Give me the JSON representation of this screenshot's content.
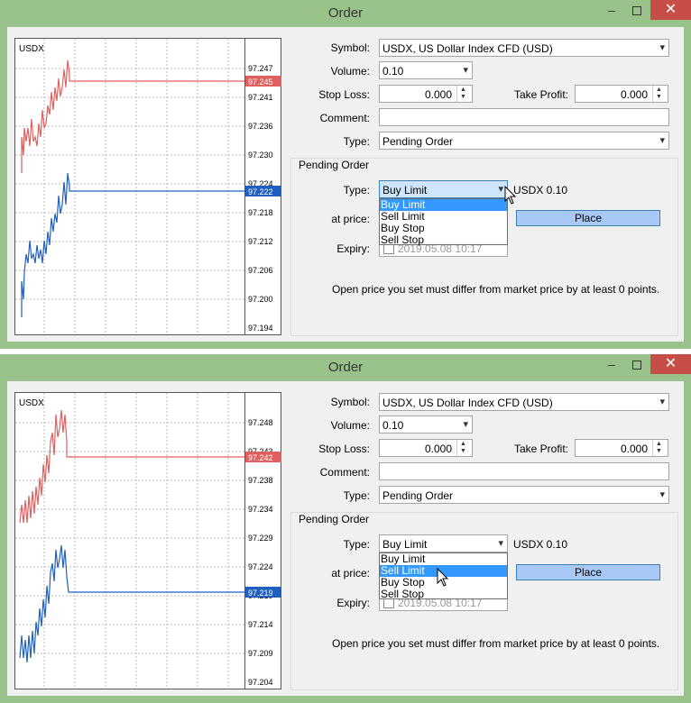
{
  "windows": [
    {
      "title": "Order",
      "chart": {
        "symbol": "USDX",
        "price_labels": [
          "97.247",
          "97.241",
          "97.236",
          "97.230",
          "97.224",
          "97.218",
          "97.212",
          "97.206",
          "97.200",
          "97.194"
        ],
        "ask_tag": "97.245",
        "bid_tag": "97.222"
      },
      "form": {
        "symbol_label": "Symbol:",
        "symbol_value": "USDX, US Dollar Index CFD (USD)",
        "volume_label": "Volume:",
        "volume_value": "0.10",
        "stop_loss_label": "Stop Loss:",
        "stop_loss_value": "0.000",
        "take_profit_label": "Take Profit:",
        "take_profit_value": "0.000",
        "comment_label": "Comment:",
        "comment_value": "",
        "type_label": "Type:",
        "type_value": "Pending Order"
      },
      "pending": {
        "group_title": "Pending Order",
        "type_label": "Type:",
        "type_value": "Buy Limit",
        "options": [
          "Buy Limit",
          "Sell Limit",
          "Buy Stop",
          "Sell Stop"
        ],
        "highlighted": "Buy Limit",
        "summary": "USDX 0.10",
        "at_price_label": "at price:",
        "place_label": "Place",
        "expiry_label": "Expiry:",
        "expiry_value": "2019.05.08 10:17",
        "note": "Open price you set must differ from market price by at least 0 points."
      }
    },
    {
      "title": "Order",
      "chart": {
        "symbol": "USDX",
        "price_labels": [
          "97.248",
          "97.243",
          "97.238",
          "97.234",
          "97.229",
          "97.224",
          "97.219",
          "97.214",
          "97.209",
          "97.204"
        ],
        "ask_tag": "97.242",
        "bid_tag": "97.219"
      },
      "form": {
        "symbol_label": "Symbol:",
        "symbol_value": "USDX, US Dollar Index CFD (USD)",
        "volume_label": "Volume:",
        "volume_value": "0.10",
        "stop_loss_label": "Stop Loss:",
        "stop_loss_value": "0.000",
        "take_profit_label": "Take Profit:",
        "take_profit_value": "0.000",
        "comment_label": "Comment:",
        "comment_value": "",
        "type_label": "Type:",
        "type_value": "Pending Order"
      },
      "pending": {
        "group_title": "Pending Order",
        "type_label": "Type:",
        "type_value": "Buy Limit",
        "options": [
          "Buy Limit",
          "Sell Limit",
          "Buy Stop",
          "Sell Stop"
        ],
        "highlighted": "Sell Limit",
        "summary": "USDX 0.10",
        "at_price_label": "at price:",
        "place_label": "Place",
        "expiry_label": "Expiry:",
        "expiry_value": "2019.05.08 10:17",
        "note": "Open price you set must differ from market price by at least 0 points."
      }
    }
  ],
  "colors": {
    "ask_line": "#e06060",
    "bid_line": "#1f5fbf",
    "highlight": "#3399ff",
    "title_bg": "#99c28a",
    "close_btn": "#c74e47"
  },
  "icons": {
    "minimize": "minimize-icon",
    "maximize": "maximize-icon",
    "close": "close-icon",
    "dropdown": "chevron-down-icon",
    "cursor": "mouse-pointer-icon"
  }
}
